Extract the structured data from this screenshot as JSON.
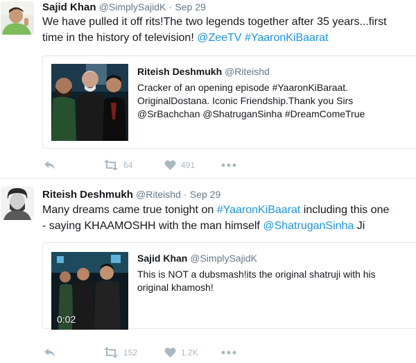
{
  "tweets": [
    {
      "author": {
        "name": "Sajid Khan",
        "handle": "@SimplySajidK",
        "dot": "·",
        "time": "Sep 29"
      },
      "text": {
        "line1": "We have pulled it off rits!The two legends together after 35 years...first",
        "line2_start": "time in the history of television!  ",
        "mention": "@ZeeTV",
        "space": " ",
        "hashtag": "#YaaronKiBaarat"
      },
      "quote": {
        "name": "Riteish Deshmukh",
        "handle": "@Riteishd",
        "lines": [
          "Cracker of an opening episode #YaaronKiBaraat.",
          "OriginalDostana. Iconic Friendship.Thank you Sirs",
          "@SrBachchan @ShatruganSinha  #DreamComeTrue"
        ]
      },
      "actions": {
        "reply_icon": "reply-icon",
        "retweets": "64",
        "likes": "491",
        "more_icon": "more-icon"
      }
    },
    {
      "author": {
        "name": "Riteish Deshmukh",
        "handle": "@Riteishd",
        "dot": "·",
        "time": "Sep 29"
      },
      "text": {
        "line1_start": "Many dreams came true tonight on ",
        "hashtag": "#YaaronKiBaarat",
        "line1_end": " including this one",
        "line2_start": "- saying KHAAMOSHH with the man himself ",
        "mention": "@ShatruganSinha",
        "line2_end": " Ji"
      },
      "quote": {
        "name": "Sajid Khan",
        "handle": "@SimplySajidK",
        "lines": [
          "This is NOT a dubsmash!its the original shatruji with his",
          "original khamosh!"
        ],
        "video_duration": "0:02"
      },
      "actions": {
        "reply_icon": "reply-icon",
        "retweets": "152",
        "likes": "1.2K",
        "more_icon": "more-icon"
      }
    }
  ],
  "colors": {
    "link": "#1b95e0",
    "muted": "#657786",
    "icon": "#aab8c2",
    "border": "#e1e8ed"
  }
}
